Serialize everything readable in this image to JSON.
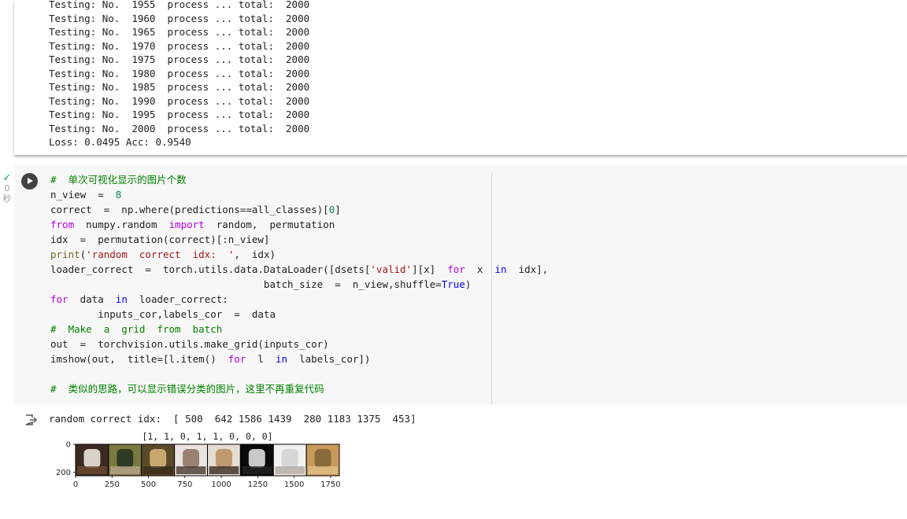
{
  "previous_output": {
    "lines": [
      "Testing: No.  1955  process ... total:  2000",
      "Testing: No.  1960  process ... total:  2000",
      "Testing: No.  1965  process ... total:  2000",
      "Testing: No.  1970  process ... total:  2000",
      "Testing: No.  1975  process ... total:  2000",
      "Testing: No.  1980  process ... total:  2000",
      "Testing: No.  1985  process ... total:  2000",
      "Testing: No.  1990  process ... total:  2000",
      "Testing: No.  1995  process ... total:  2000",
      "Testing: No.  2000  process ... total:  2000",
      "Loss: 0.0495 Acc: 0.9540"
    ]
  },
  "code_cell": {
    "exec_time_value": "0",
    "exec_time_unit": "秒",
    "code_lines": [
      "#  单次可视化显示的图片个数",
      "n_view  =  8",
      "correct  =  np.where(predictions==all_classes)[0]",
      "from  numpy.random  import  random,  permutation",
      "idx  =  permutation(correct)[:n_view]",
      "print('random  correct  idx:  ',  idx)",
      "loader_correct  =  torch.utils.data.DataLoader([dsets['valid'][x]  for  x  in  idx],",
      "                                    batch_size  =  n_view,shuffle=True)",
      "for  data  in  loader_correct:",
      "        inputs_cor,labels_cor  =  data",
      "#  Make  a  grid  from  batch",
      "out  =  torchvision.utils.make_grid(inputs_cor)",
      "imshow(out,  title=[l.item()  for  l  in  labels_cor])",
      "",
      "#  类似的思路，可以显示错误分类的图片，这里不再重复代码"
    ]
  },
  "cell_output": {
    "text": "random correct idx:  [ 500  642 1586 1439  280 1183 1375  453]"
  },
  "chart_data": {
    "type": "image",
    "title": "[1, 1, 0, 1, 1, 0, 0, 0]",
    "xticks": [
      "0",
      "250",
      "500",
      "750",
      "1000",
      "1250",
      "1500",
      "1750"
    ],
    "yticks": [
      "0",
      "200"
    ],
    "xlim": [
      0,
      1810
    ],
    "ylim": [
      226,
      0
    ],
    "tiles": [
      {
        "label": "dog",
        "colors": [
          "#3b2a22",
          "#d8d2c8",
          "#6b4a30"
        ]
      },
      {
        "label": "dog",
        "colors": [
          "#7a7a40",
          "#2f3a22",
          "#b8a48a"
        ]
      },
      {
        "label": "cat",
        "colors": [
          "#5a4a2a",
          "#c9a870",
          "#3a2a18"
        ]
      },
      {
        "label": "dog",
        "colors": [
          "#e8e4e0",
          "#9a8070",
          "#4a3a30"
        ]
      },
      {
        "label": "dog",
        "colors": [
          "#e2dcd2",
          "#c09870",
          "#3a2a22"
        ]
      },
      {
        "label": "cat",
        "colors": [
          "#0a0a0a",
          "#c8c8c8",
          "#202020"
        ]
      },
      {
        "label": "cat",
        "colors": [
          "#f2f0ee",
          "#d8d6d4",
          "#b0aaa4"
        ]
      },
      {
        "label": "cat",
        "colors": [
          "#c89a5a",
          "#8a6a3a",
          "#e2c08a"
        ]
      }
    ]
  }
}
